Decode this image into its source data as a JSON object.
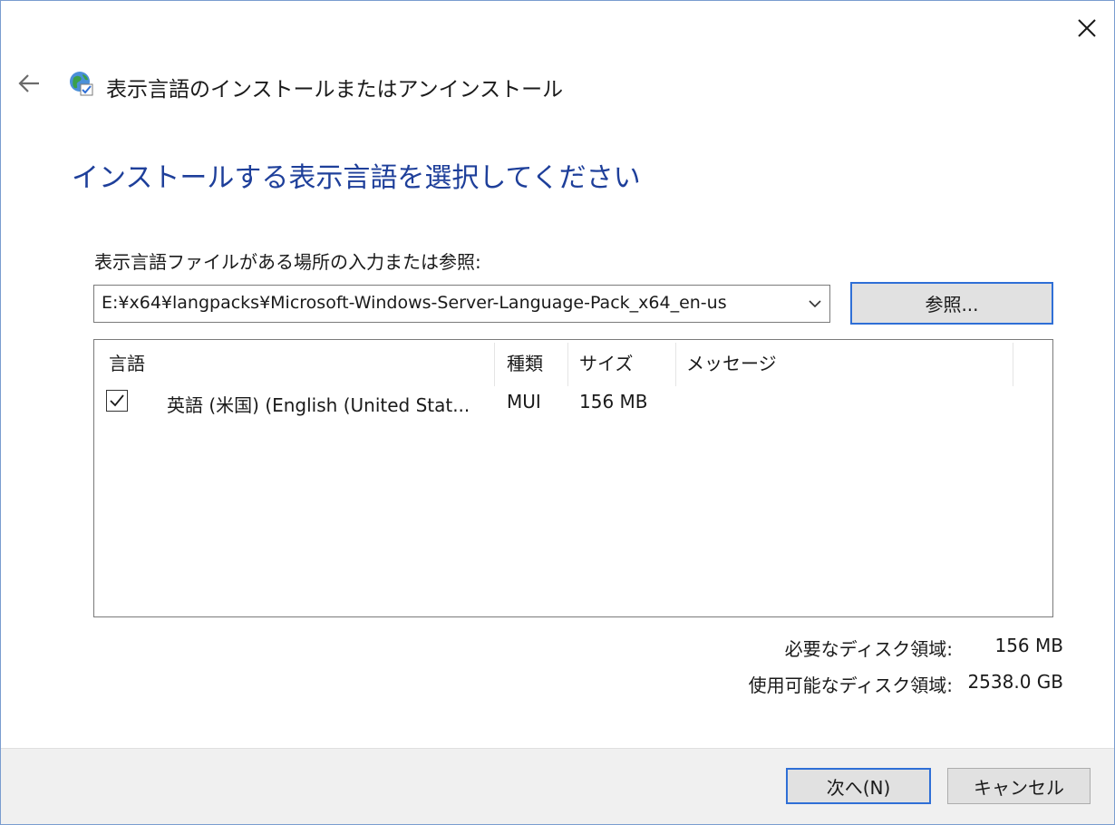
{
  "window": {
    "title": "表示言語のインストールまたはアンインストール"
  },
  "heading": "インストールする表示言語を選択してください",
  "path": {
    "label": "表示言語ファイルがある場所の入力または参照:",
    "value": "E:¥x64¥langpacks¥Microsoft-Windows-Server-Language-Pack_x64_en-us",
    "browse_label": "参照..."
  },
  "list": {
    "columns": [
      "言語",
      "種類",
      "サイズ",
      "メッセージ"
    ],
    "rows": [
      {
        "checked": true,
        "language": "英語 (米国) (English (United Stat...",
        "type": "MUI",
        "size": "156 MB",
        "message": ""
      }
    ]
  },
  "disk": {
    "required_label": "必要なディスク領域:",
    "required_value": "156 MB",
    "available_label": "使用可能なディスク領域:",
    "available_value": "2538.0 GB"
  },
  "footer": {
    "next_label": "次へ(N)",
    "cancel_label": "キャンセル"
  },
  "icons": {
    "close": "close-icon",
    "back": "back-arrow-icon",
    "app": "globe-language-icon",
    "dropdown": "chevron-down-icon",
    "check": "checkmark-icon"
  },
  "colors": {
    "heading": "#1e3f9a",
    "focus_border": "#2f6fd6",
    "button_face": "#e1e1e1",
    "footer_bg": "#f0f0f0"
  }
}
